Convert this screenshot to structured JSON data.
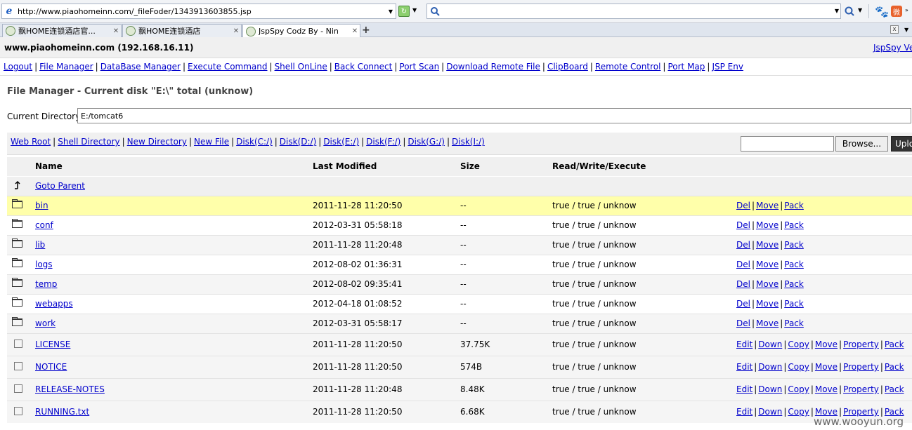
{
  "browser": {
    "address_url": "http://www.piaohomeinn.com/_fileFoder/1343913603855.jsp",
    "search_value": "",
    "tabs": [
      {
        "label": "飘HOME连锁酒店官..."
      },
      {
        "label": "飘HOME连锁酒店"
      },
      {
        "label": "JspSpy Codz By - Nin"
      }
    ]
  },
  "header": {
    "host": "www.piaohomeinn.com (192.168.16.11)",
    "version_link": "JspSpy Ve"
  },
  "nav": [
    "Logout",
    "File Manager",
    "DataBase Manager",
    "Execute Command",
    "Shell OnLine",
    "Back Connect",
    "Port Scan",
    "Download Remote File",
    "ClipBoard",
    "Remote Control",
    "Port Map",
    "JSP Env"
  ],
  "page": {
    "title": "File Manager - Current disk \"E:\\\" total (unknow)",
    "current_dir_label": "Current Directory",
    "current_dir_value": "E:/tomcat6"
  },
  "toolbar": {
    "links": [
      "Web Root",
      "Shell Directory",
      "New Directory",
      "New File",
      "Disk(C:/)",
      "Disk(D:/)",
      "Disk(E:/)",
      "Disk(F:/)",
      "Disk(G:/)",
      "Disk(I:/)"
    ],
    "browse_label": "Browse...",
    "upload_label": "Upload"
  },
  "table": {
    "headers": {
      "name": "Name",
      "modified": "Last Modified",
      "size": "Size",
      "rwx": "Read/Write/Execute"
    },
    "parent_label": "Goto Parent",
    "dirs": [
      {
        "name": "bin",
        "modified": "2011-11-28 11:20:50",
        "size": "--",
        "rwx": "true / true / unknow"
      },
      {
        "name": "conf",
        "modified": "2012-03-31 05:58:18",
        "size": "--",
        "rwx": "true / true / unknow"
      },
      {
        "name": "lib",
        "modified": "2011-11-28 11:20:48",
        "size": "--",
        "rwx": "true / true / unknow"
      },
      {
        "name": "logs",
        "modified": "2012-08-02 01:36:31",
        "size": "--",
        "rwx": "true / true / unknow"
      },
      {
        "name": "temp",
        "modified": "2012-08-02 09:35:41",
        "size": "--",
        "rwx": "true / true / unknow"
      },
      {
        "name": "webapps",
        "modified": "2012-04-18 01:08:52",
        "size": "--",
        "rwx": "true / true / unknow"
      },
      {
        "name": "work",
        "modified": "2012-03-31 05:58:17",
        "size": "--",
        "rwx": "true / true / unknow"
      }
    ],
    "dir_actions": [
      "Del",
      "Move",
      "Pack"
    ],
    "files": [
      {
        "name": "LICENSE",
        "modified": "2011-11-28 11:20:50",
        "size": "37.75K",
        "rwx": "true / true / unknow"
      },
      {
        "name": "NOTICE",
        "modified": "2011-11-28 11:20:50",
        "size": "574B",
        "rwx": "true / true / unknow"
      },
      {
        "name": "RELEASE-NOTES",
        "modified": "2011-11-28 11:20:48",
        "size": "8.48K",
        "rwx": "true / true / unknow"
      },
      {
        "name": "RUNNING.txt",
        "modified": "2011-11-28 11:20:50",
        "size": "6.68K",
        "rwx": "true / true / unknow"
      }
    ],
    "file_actions": [
      "Edit",
      "Down",
      "Copy",
      "Move",
      "Property",
      "Pack"
    ]
  },
  "watermark": "www.wooyun.org",
  "colors": {
    "highlight_row": "#ffffaa",
    "link": "#0000cc",
    "toolbar_bg": "#f0f0f0"
  }
}
